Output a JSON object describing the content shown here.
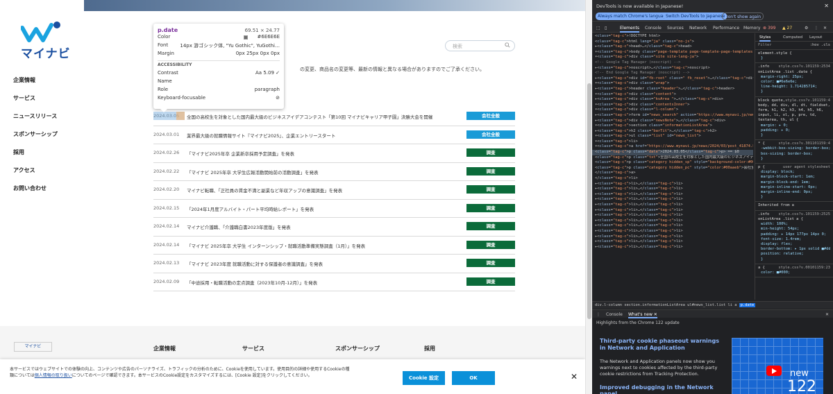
{
  "site": {
    "logo_text": "マイナビ",
    "search_placeholder": "検索",
    "notice": "の変更、商品名の変更等、最新の情報と異なる場合がありますのでご了承ください。",
    "side_nav": [
      "企業情報",
      "サービス",
      "ニュースリリース",
      "スポンサーシップ",
      "採用",
      "アクセス",
      "お問い合わせ"
    ],
    "news": [
      {
        "date": "2024.03.05",
        "title": "全国の高校生を対象とした国内最大級のビジネスアイデアコンテスト「第10回 マイナビキャリア甲子園」決勝大会を開催",
        "tag": "会社全般",
        "tag_color": "#1a9bd7"
      },
      {
        "date": "2024.03.01",
        "title": "業界最大級の就職情報サイト『マイナビ2025』、企業エントリースタート",
        "tag": "会社全般",
        "tag_color": "#1a9bd7"
      },
      {
        "date": "2024.02.26",
        "title": "「マイナビ2025年卒 企業新卒採用予定調査」を発表",
        "tag": "調査",
        "tag_color": "#0b6b3a"
      },
      {
        "date": "2024.02.22",
        "title": "「マイナビ 2025年卒 大学生広報活動開始前の活動調査」を発表",
        "tag": "調査",
        "tag_color": "#0b6b3a"
      },
      {
        "date": "2024.02.20",
        "title": "マイナビ転職、「正社員の賃金不満と副業など年収アップの意識調査」を発表",
        "tag": "調査",
        "tag_color": "#0b6b3a"
      },
      {
        "date": "2024.02.15",
        "title": "「2024年1月度アルバイト・パート平均時給レポート」を発表",
        "tag": "調査",
        "tag_color": "#0b6b3a"
      },
      {
        "date": "2024.02.14",
        "title": "マイナビ介護職、「介護職白書2023年度版」を発表",
        "tag": "調査",
        "tag_color": "#0b6b3a"
      },
      {
        "date": "2024.02.14",
        "title": "「マイナビ 2025年卒 大学生 インターンシップ・就職活動準備実態調査（1月）」を発表",
        "tag": "調査",
        "tag_color": "#0b6b3a"
      },
      {
        "date": "2024.02.13",
        "title": "「マイナビ 2023年度 就職活動に対する保護者の意識調査」を発表",
        "tag": "調査",
        "tag_color": "#0b6b3a"
      },
      {
        "date": "2024.02.09",
        "title": "「中途採用・転職活動の定点調査（2023年10月-12月）」を発表",
        "tag": "調査",
        "tag_color": "#0b6b3a"
      }
    ],
    "footer_cols": [
      "企業情報",
      "サービス",
      "スポンサーシップ",
      "採用"
    ],
    "footer_logo": "マイナビ",
    "cookie": {
      "text_1": "本サービスではウェブサイトでの体験の向上、コンテンツや広告のパーソナライズ、トラフィックの分析のために、Cookieを使用しています。使用目的の詳細や使用するCookieの種類については",
      "link": "個人情報の取り扱い",
      "text_2": "についてのページで確認できます。本サービスのCookie設定をカスタマイズするには、[Cookie 設定]をクリックしてください。",
      "settings_label": "Cookie 設定",
      "ok_label": "OK",
      "close": "✕"
    }
  },
  "tooltip": {
    "title": "p.date",
    "size": "69.51 × 24.77",
    "rows": [
      {
        "k": "Color",
        "v": "#6E6E6E"
      },
      {
        "k": "Font",
        "v": "14px 游ゴシック体, \"Yu Gothic\", YuGothi…"
      },
      {
        "k": "Margin",
        "v": "0px 25px 0px 0px"
      }
    ],
    "accessibility_label": "ACCESSIBILITY",
    "acc_rows": [
      {
        "k": "Contrast",
        "v": "Aa  5.09 ✓"
      },
      {
        "k": "Name",
        "v": ""
      },
      {
        "k": "Role",
        "v": "paragraph"
      },
      {
        "k": "Keyboard-focusable",
        "v": "⊘"
      }
    ]
  },
  "devtools": {
    "info_msg": "DevTools is now available in Japanese!",
    "btn_match": "Always match Chrome's language",
    "btn_switch": "Switch DevTools to Japanese",
    "btn_dismiss": "Don't show again",
    "tabs": [
      "Elements",
      "Console",
      "Sources",
      "Network",
      "Performance",
      "Memory"
    ],
    "errors": "399",
    "warnings": "27",
    "dom_lines": [
      "<!DOCTYPE html>",
      "<html lang=\"ja\" class=\"no-js\">",
      "▸<head>…</head>",
      "▾<body class=\"page-template page-template-page-templates page-template-news page-template-templatesnews-php page page-id-24808 desktop-device\">",
      "  ▾<div class=\"site site-lang-ja\">",
      "    <!-- Google Tag Manager (noscript) -->",
      "    ▸<noscript>…</noscript>",
      "    <!-- End Google Tag Manager (noscript) -->",
      "    ▸<div id=\"fb-root\" class=\" fb_reset\">…</div>",
      "    ▾<div class=\"wrap\">",
      "      ▸<header class=\"header\">…</header>",
      "      ▾<div class=\"content\">",
      "        ▸<div class=\"kvArea \">…</div>",
      "        ▾<div class=\"contentsInner\">",
      "          ▾<div class=\"l-column\">",
      "            ▸<form id=\"news_search\" action=\"https://www.mynavi.jp/news/\" method=\"post\">…</form>",
      "            ▸<div class=\"newsNote\">…</div>",
      "            ▾<section class=\"informationListArea\">",
      "              ▸<h2 class=\"barTit\">…</h2>",
      "              ▾<ul class=\"list\" id=\"news_list\">",
      "                ▾<li>",
      "                  ▾<a href=\"https://www.mynavi.jp/news/2024/03/post_41874.html\">",
      "                      <p class=\"date\">2024.03.05</p> == $0",
      "                      <p class=\"txt\">全国の高校生を対象とした国内最大級のビジネスアイデアコンテスト「第10回 マイナビキャリア甲子園」決勝大会を開催</p>",
      "                      <p class=\"category hidden_sp\" style=\"background-color:#00aaeb\">会社全般</p>",
      "                      <p class=\"category hidden_pc\" style=\"color:#00aaeb\">会社全般</p>",
      "                    </a>",
      "                  </li>",
      "                ▸<li>…</li>",
      "                ▸<li>…</li>",
      "                ▸<li>…</li>",
      "                ▸<li>…</li>",
      "                ▸<li>…</li>",
      "                ▸<li>…</li>",
      "                ▸<li>…</li>",
      "                ▸<li>…</li>",
      "                ▸<li>…</li>",
      "                ▸<li>…</li>",
      "                ▸<li>…</li>",
      "                ▸<li>…</li>",
      "                ▸<li>…</li>"
    ],
    "styles_tabs": [
      "Styles",
      "Computed",
      "Layout"
    ],
    "filter_placeholder": "Filter",
    "filter_tools": ":hov .cls",
    "style_blocks": [
      {
        "sel": "element.style {",
        "src": "",
        "props": [
          "}"
        ]
      },
      {
        "sel": ".info onListArea .list .date {",
        "src": "style.css?v.101159:2534",
        "props": [
          "margin-right: 25px;",
          "color: ■#6e6e6e;",
          "line-height: 1.714285714;",
          "}"
        ]
      },
      {
        "sel": "block quote, body, dd, div, dl, dt, fieldset, form, h1, h2, h3, h4, h5, h6, input, li, ol, p, pre, td, textarea, th, ul {",
        "src": "style.css?v.101159:4",
        "props": [
          "margin: ▸ 0;",
          "padding: ▸ 0;",
          "}"
        ]
      },
      {
        "sel": "* {",
        "src": "style.css?v.301101159:4",
        "props": [
          "-webkit-box-sizing: border-box;",
          "box-sizing: border-box;",
          "}"
        ]
      },
      {
        "sel": "p {",
        "src": "user agent stylesheet",
        "props": [
          "display: block;",
          "margin-block-start: 1em;",
          "margin-block-end: 1em;",
          "margin-inline-start: 0px;",
          "margin-inline-end: 0px;",
          "}"
        ]
      },
      {
        "sel": "Inherited from a",
        "src": "",
        "props": []
      },
      {
        "sel": ".info onListArea .list a {",
        "src": "style.css?v.101159:2525",
        "props": [
          "width: 100%;",
          "min-height: 54px;",
          "padding: ▸ 14px 177px 14px 0;",
          "font-size: 1.4rem;",
          "display: flex;",
          "border-bottom: ▸ 1px solid ■#ddd;",
          "position: relative;",
          "}"
        ]
      },
      {
        "sel": "a {",
        "src": "style.css?v.00101159:23",
        "props": [
          "color: ■#000;"
        ]
      }
    ],
    "crumbs": [
      "div.l-column",
      "section.informationListArea",
      "ul#news_list.list",
      "li",
      "a",
      "p.date"
    ],
    "drawer_tabs": [
      "Console",
      "What's new ✕"
    ],
    "wn_header": "Highlights from the Chrome 122 update",
    "wn_h1": "Third-party cookie phaseout warnings in Network and Application",
    "wn_p": "The Network and Application panels now show you warnings next to cookies affected by the third-party cookie restrictions from Tracking Protection.",
    "wn_h2": "Improved debugging in the Network panel",
    "promo_new": "new",
    "promo_num": "122"
  }
}
